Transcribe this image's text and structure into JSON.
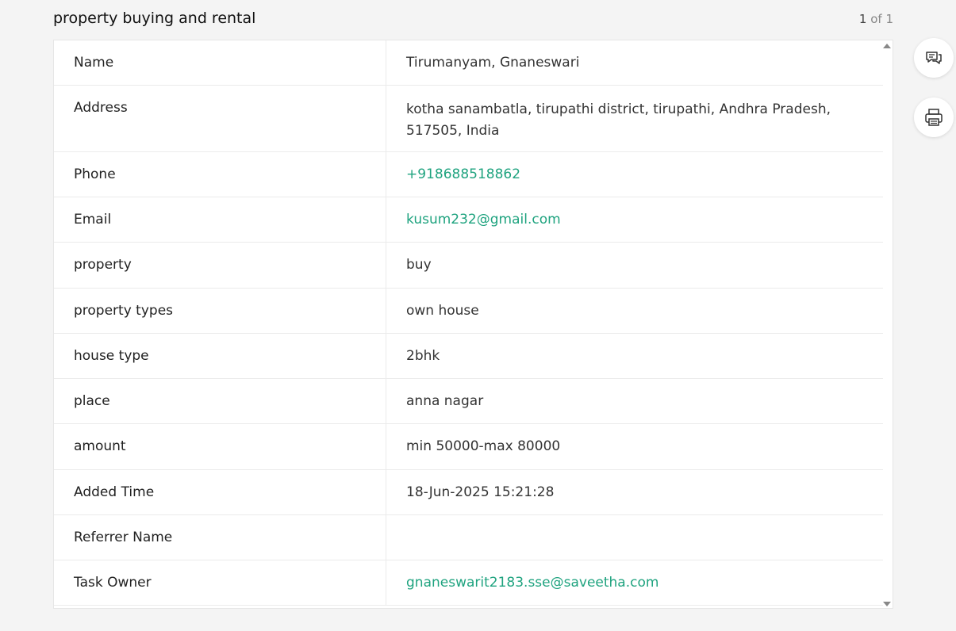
{
  "header": {
    "title": "property buying and rental",
    "pager_current": "1",
    "pager_rest": " of 1"
  },
  "record": {
    "rows": [
      {
        "label": "Name",
        "value": "Tirumanyam, Gnaneswari",
        "link": false
      },
      {
        "label": "Address",
        "value": "kotha sanambatla, tirupathi district, tirupathi, Andhra Pradesh, 517505, India",
        "link": false
      },
      {
        "label": "Phone",
        "value": "+918688518862",
        "link": true
      },
      {
        "label": "Email",
        "value": "kusum232@gmail.com",
        "link": true
      },
      {
        "label": "property",
        "value": "buy",
        "link": false
      },
      {
        "label": "property types",
        "value": "own house",
        "link": false
      },
      {
        "label": "house type",
        "value": "2bhk",
        "link": false
      },
      {
        "label": "place",
        "value": "anna nagar",
        "link": false
      },
      {
        "label": "amount",
        "value": "min 50000-max 80000",
        "link": false
      },
      {
        "label": "Added Time",
        "value": "18-Jun-2025 15:21:28",
        "link": false
      },
      {
        "label": "Referrer Name",
        "value": "",
        "link": false
      },
      {
        "label": "Task Owner",
        "value": "gnaneswarit2183.sse@saveetha.com",
        "link": true
      }
    ]
  },
  "actions": {
    "comment_icon": "comment-icon",
    "print_icon": "print-icon"
  },
  "colors": {
    "link": "#1fa37f",
    "background": "#f4f4f4"
  }
}
